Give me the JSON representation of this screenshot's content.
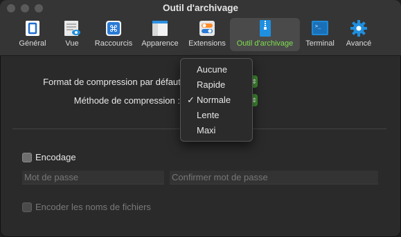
{
  "window": {
    "title": "Outil d'archivage"
  },
  "toolbar": {
    "items": [
      {
        "label": "Général",
        "icon": "general-icon"
      },
      {
        "label": "Vue",
        "icon": "view-icon"
      },
      {
        "label": "Raccourcis",
        "icon": "shortcuts-icon"
      },
      {
        "label": "Apparence",
        "icon": "appearance-icon"
      },
      {
        "label": "Extensions",
        "icon": "extensions-icon"
      },
      {
        "label": "Outil d'archivage",
        "icon": "archive-icon",
        "active": true
      },
      {
        "label": "Terminal",
        "icon": "terminal-icon"
      },
      {
        "label": "Avancé",
        "icon": "gear-icon"
      }
    ],
    "active_color": "#7fe04e"
  },
  "settings": {
    "format_label": "Format de compression par défaut :",
    "method_label": "Méthode de compression :"
  },
  "menu": {
    "items": [
      "Aucune",
      "Rapide",
      "Normale",
      "Lente",
      "Maxi"
    ],
    "selected": "Normale",
    "check": "✓"
  },
  "encoding": {
    "checkbox_label": "Encodage",
    "password_placeholder": "Mot de passe",
    "confirm_placeholder": "Confirmer mot de passe",
    "encode_names_label": "Encoder les noms de fichiers"
  }
}
